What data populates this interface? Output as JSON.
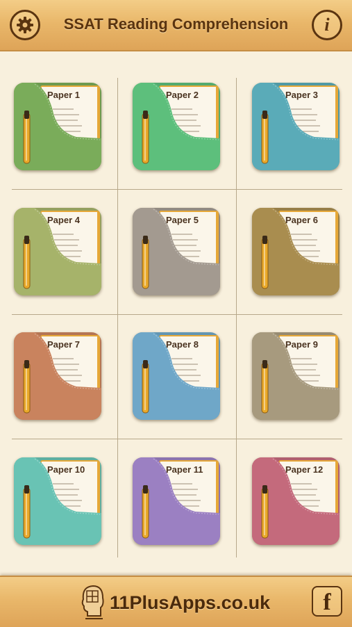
{
  "header": {
    "title": "SSAT Reading Comprehension",
    "settings_icon": "gear-icon",
    "info_label": "i"
  },
  "papers": [
    {
      "label": "Paper 1",
      "color": "#7aac5a"
    },
    {
      "label": "Paper 2",
      "color": "#5dbf7c"
    },
    {
      "label": "Paper 3",
      "color": "#5aabb8"
    },
    {
      "label": "Paper 4",
      "color": "#a6b36a"
    },
    {
      "label": "Paper 5",
      "color": "#a39a90"
    },
    {
      "label": "Paper 6",
      "color": "#a98d4f"
    },
    {
      "label": "Paper 7",
      "color": "#c9835e"
    },
    {
      "label": "Paper 8",
      "color": "#6fa7c8"
    },
    {
      "label": "Paper 9",
      "color": "#a79a7e"
    },
    {
      "label": "Paper 10",
      "color": "#69c3b4"
    },
    {
      "label": "Paper 11",
      "color": "#9b80c2"
    },
    {
      "label": "Paper 12",
      "color": "#c46a7c"
    }
  ],
  "footer": {
    "brand": "11PlusApps.co.uk",
    "facebook_label": "f"
  }
}
